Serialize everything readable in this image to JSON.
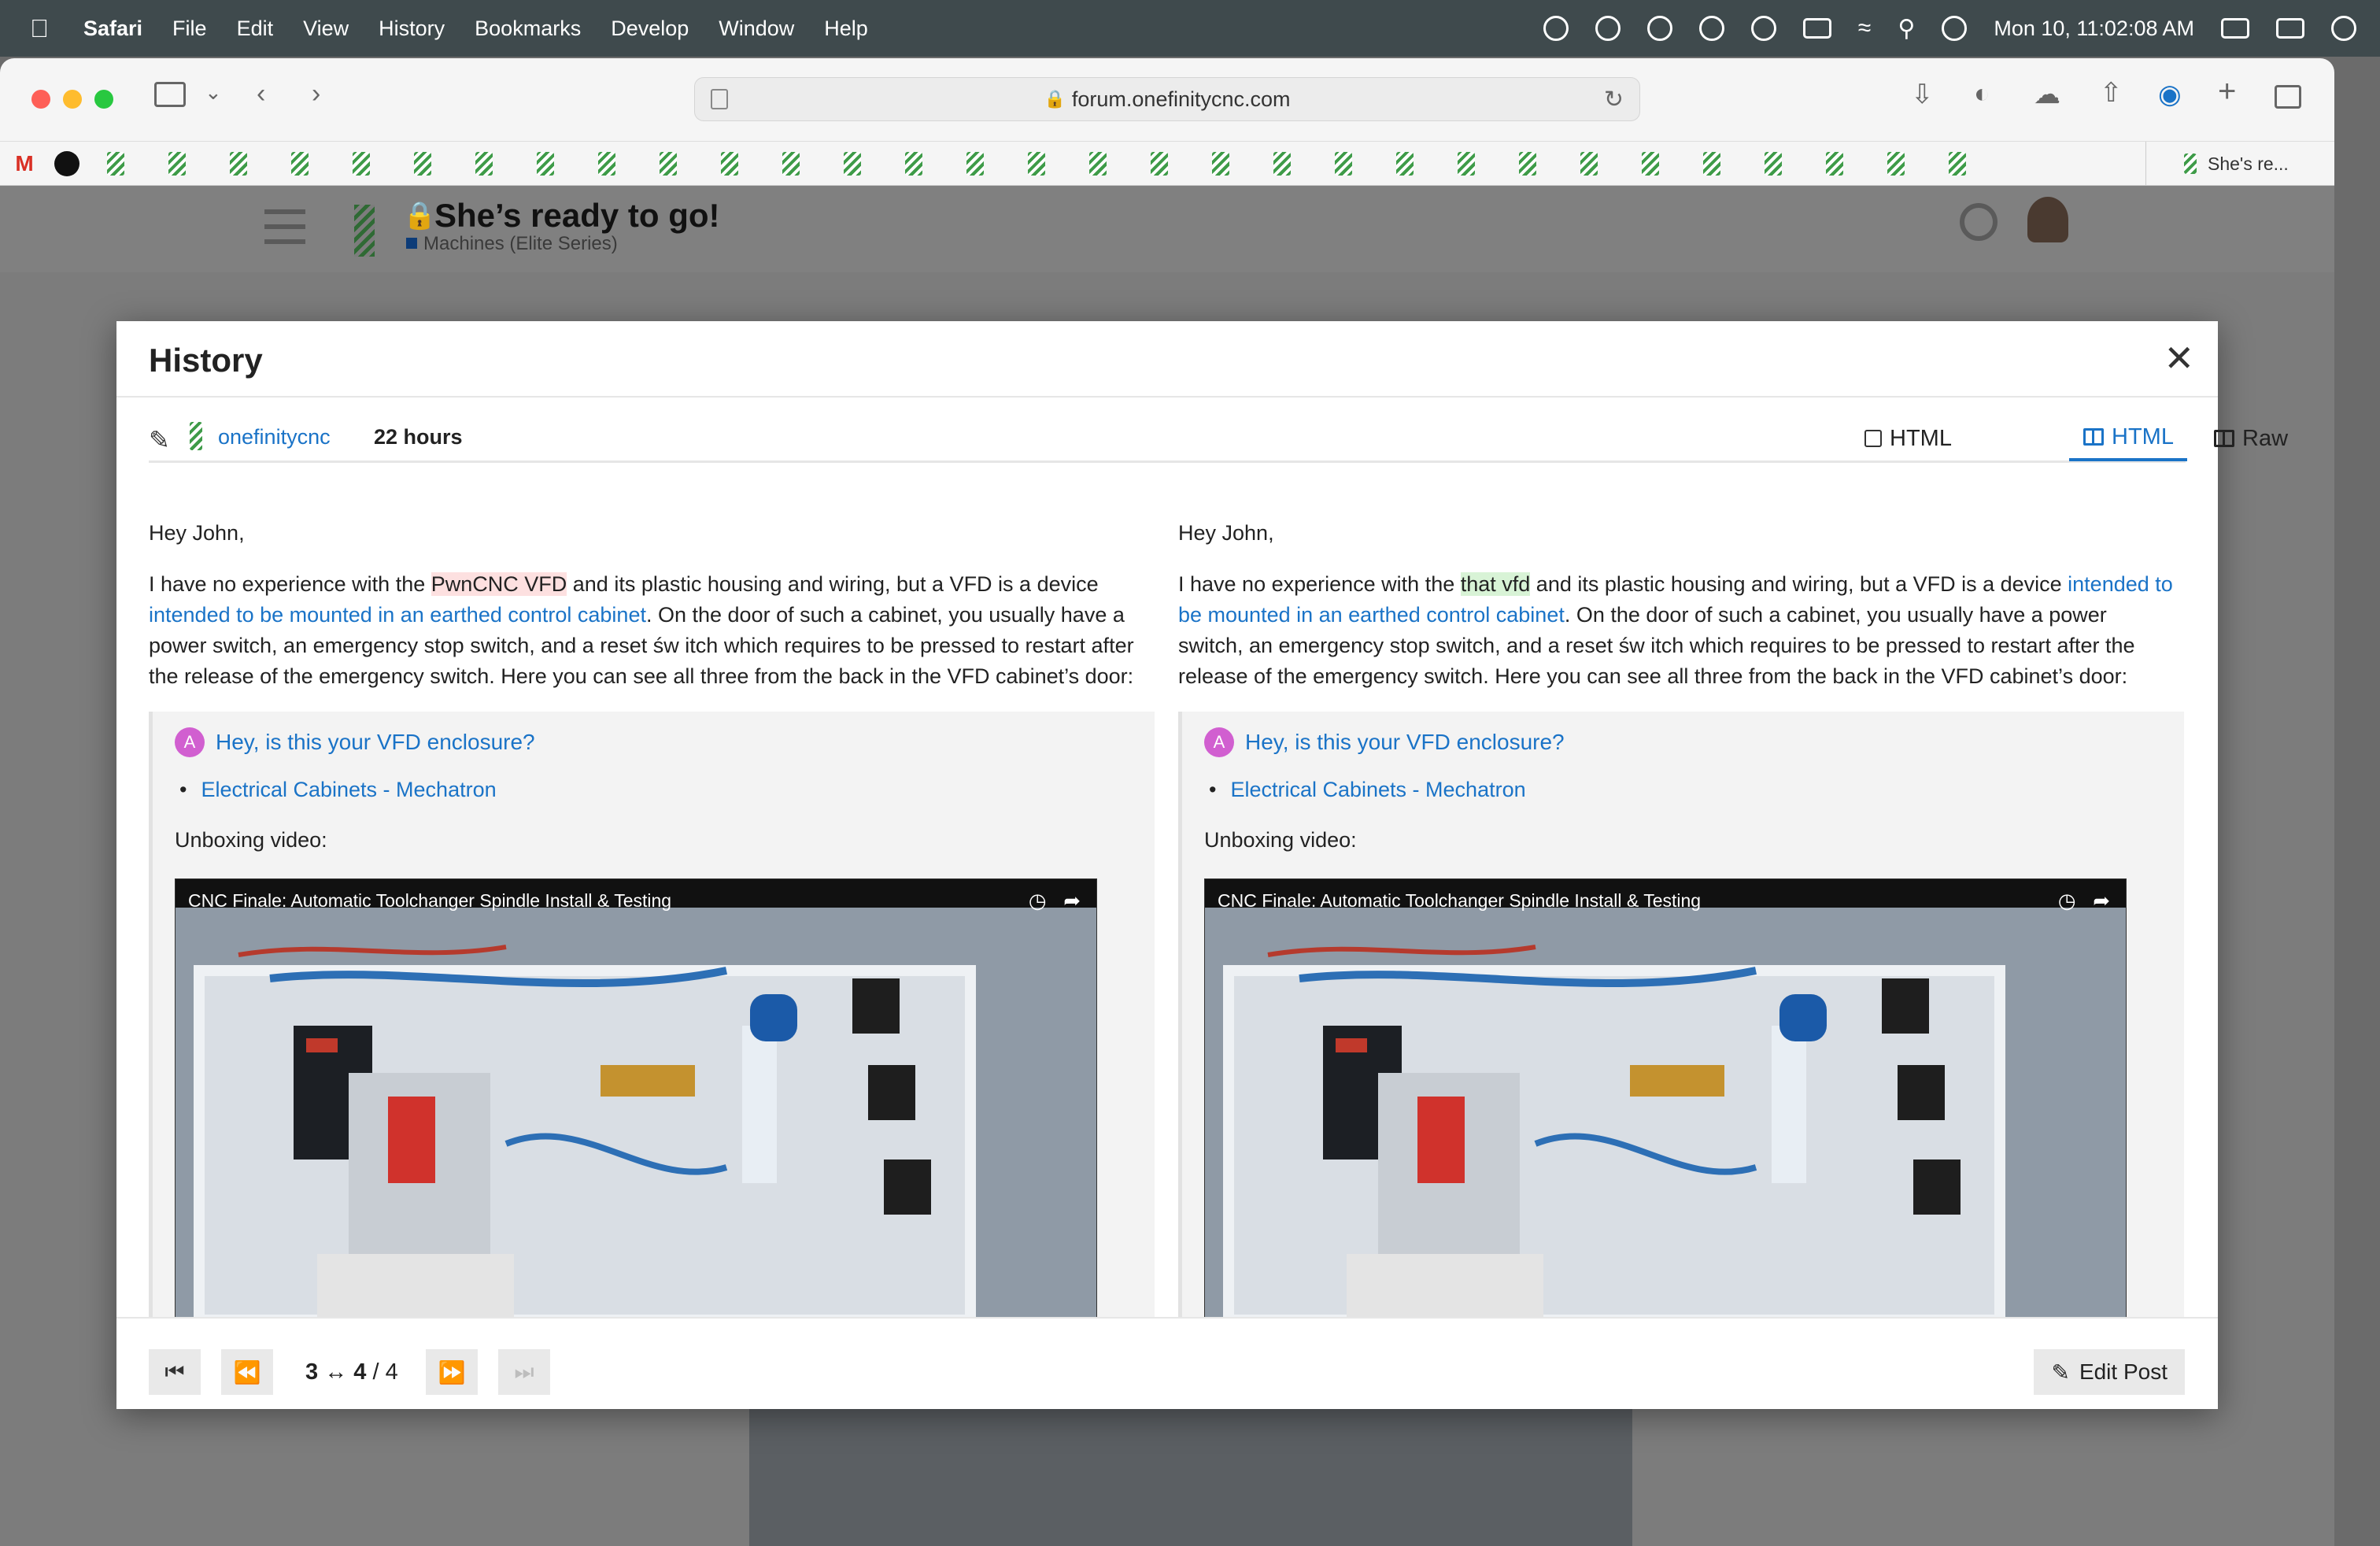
{
  "menubar": {
    "app": "Safari",
    "items": [
      "File",
      "Edit",
      "View",
      "History",
      "Bookmarks",
      "Develop",
      "Window",
      "Help"
    ],
    "clock": "Mon 10, 11:02:08 AM"
  },
  "browser": {
    "url": "forum.onefinitycnc.com",
    "bookmark_tab_title": "She's re..."
  },
  "forum": {
    "topic_title": "She’s ready to go!",
    "category": "Machines (Elite Series)"
  },
  "modal": {
    "title": "History",
    "close_glyph": "✕",
    "revision": {
      "user": "onefinitycnc",
      "age": "22 hours"
    },
    "tabs": [
      {
        "label": "HTML"
      },
      {
        "label": "HTML"
      },
      {
        "label": "Raw"
      }
    ],
    "active_tab": 1,
    "left": {
      "greeting": "Hey John,",
      "p_before": "I have no experience with the ",
      "p_changed": "PwnCNC VFD",
      "p_mid": " and its plastic housing and wiring, but a VFD is a device ",
      "p_link": "intended to be mounted in an earthed control cabinet",
      "p_after": ". On the door of such a cabinet, you usually have a power switch, an emergency stop switch, and a reset św itch which requires to be pressed to restart after the release of the emergency switch. Here you can see all three from the back in the VFD cabinet’s door:"
    },
    "right": {
      "greeting": "Hey John,",
      "p_before": "I have no experience with the ",
      "p_changed": "that vfd",
      "p_mid": " and its plastic housing and wiring, but a VFD is a device ",
      "p_link": "intended to be mounted in an earthed control cabinet",
      "p_after": ". On the door of such a cabinet, you usually have a power switch, an emergency stop switch, and a reset św itch which requires to be pressed to restart after the release of the emergency switch. Here you can see all three from the back in the VFD cabinet’s door:"
    },
    "quote": {
      "avatar_letter": "A",
      "link": "Hey, is this your VFD enclosure?",
      "bullet": "Electrical Cabinets - Mechatron",
      "unboxing": "Unboxing video:",
      "video_title": "CNC Finale: Automatic Toolchanger Spindle Install & Testing"
    },
    "footer": {
      "from": "3",
      "arrow": "↔",
      "to": "4",
      "total": "/ 4",
      "edit_label": "Edit Post"
    }
  }
}
